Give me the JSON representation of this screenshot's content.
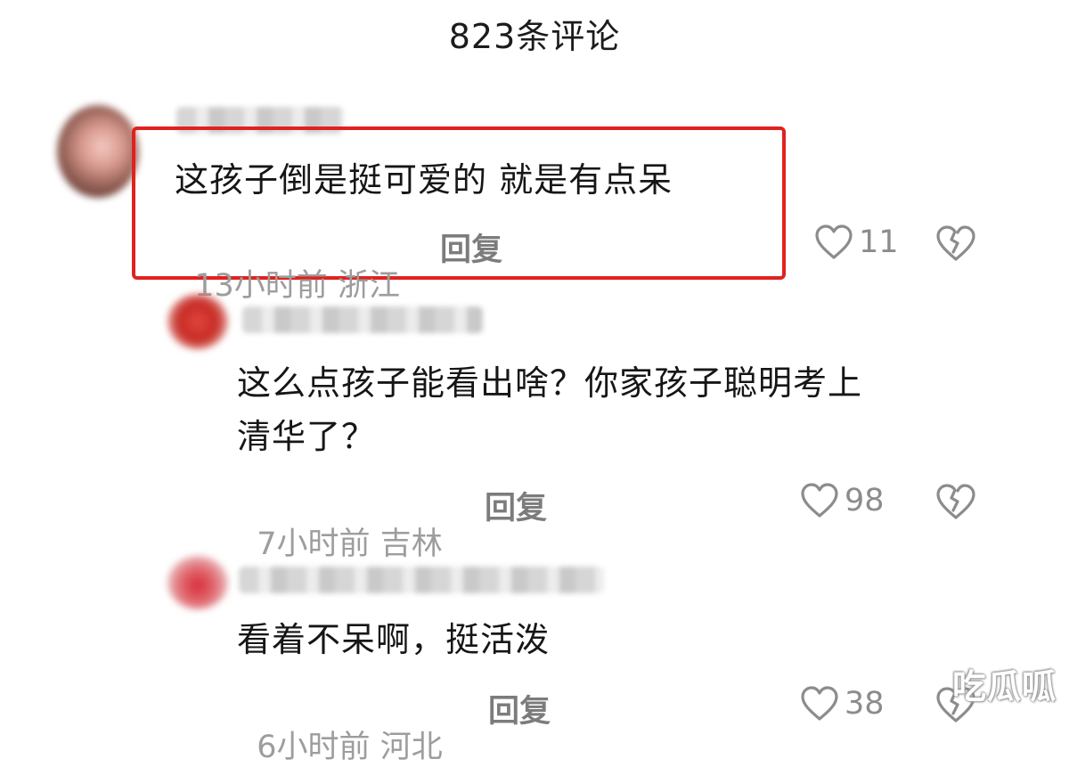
{
  "header": {
    "title": "823条评论"
  },
  "comments": [
    {
      "text": "这孩子倒是挺可爱的   就是有点呆",
      "time": "13小时前",
      "location": "浙江",
      "reply_label": "回复",
      "likes": "11",
      "highlighted": true
    }
  ],
  "replies": [
    {
      "text_line1": "这么点孩子能看出啥？你家孩子聪明考上",
      "text_line2": "清华了？",
      "time": "7小时前",
      "location": "吉林",
      "reply_label": "回复",
      "likes": "98"
    },
    {
      "text_line1": "看着不呆啊，挺活泼",
      "time": "6小时前",
      "location": "河北",
      "reply_label": "回复",
      "likes": "38"
    }
  ],
  "icons": {
    "like": "heart-outline-icon",
    "dislike": "broken-heart-icon"
  },
  "colors": {
    "highlight": "#e0221f",
    "meta": "#9d9d9d"
  },
  "watermark": "吃瓜呱"
}
